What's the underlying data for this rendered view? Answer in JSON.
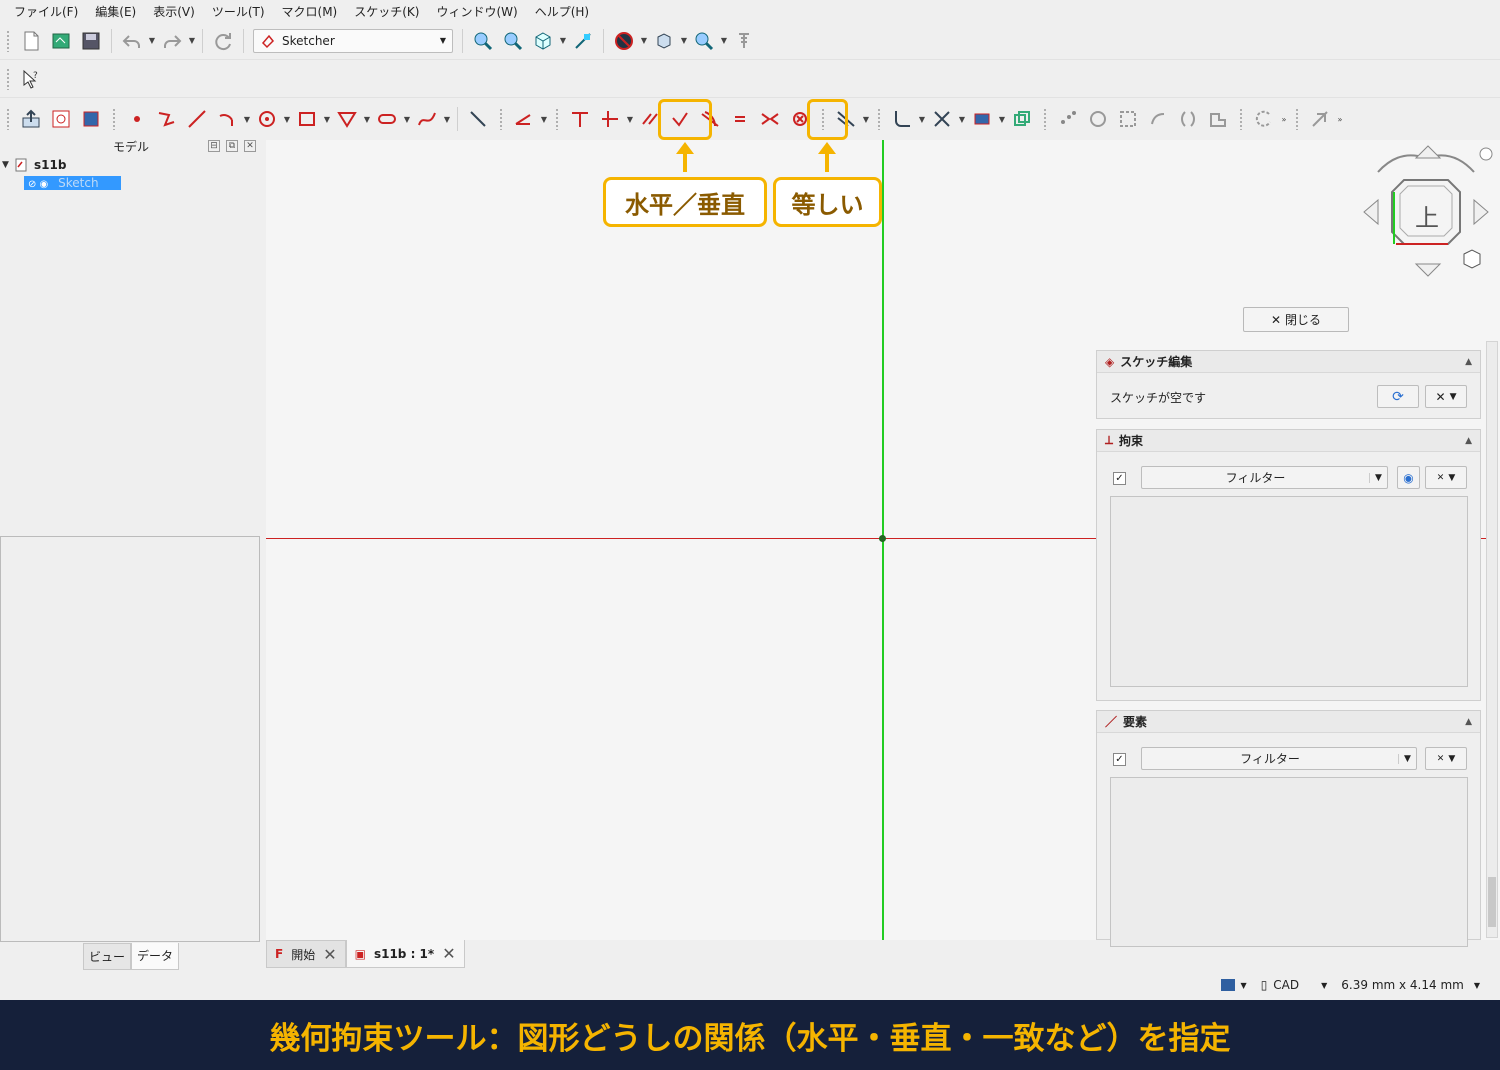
{
  "menubar": {
    "items": [
      "ファイル(F)",
      "編集(E)",
      "表示(V)",
      "ツール(T)",
      "マクロ(M)",
      "スケッチ(K)",
      "ウィンドウ(W)",
      "ヘルプ(H)"
    ]
  },
  "toolbar": {
    "workbench": "Sketcher"
  },
  "model_panel": {
    "title": "モデル",
    "root": "s11b",
    "child": "Sketch",
    "tabs": [
      "ビュー",
      "データ"
    ],
    "active_tab": "データ"
  },
  "callouts": {
    "horizontal_vertical": "水平／垂直",
    "equal": "等しい"
  },
  "navcube": {
    "face": "上"
  },
  "task_panel": {
    "close_label": "閉じる",
    "sketch_edit": {
      "title": "スケッチ編集",
      "status": "スケッチが空です"
    },
    "constraints": {
      "title": "拘束",
      "filter": "フィルター"
    },
    "elements": {
      "title": "要素",
      "filter": "フィルター"
    }
  },
  "doc_tabs": [
    {
      "label": "開始",
      "active": false
    },
    {
      "label": "s11b : 1*",
      "active": true
    }
  ],
  "statusbar": {
    "nav_style": "CAD",
    "dimensions": "6.39 mm x 4.14 mm"
  },
  "caption": "幾何拘束ツール：図形どうしの関係（水平・垂直・一致など）を指定",
  "colors": {
    "accent": "#f5b400",
    "caption_bg": "#15203a",
    "x_axis": "#cc2222",
    "y_axis": "#22cc22",
    "selection": "#3399ff"
  }
}
